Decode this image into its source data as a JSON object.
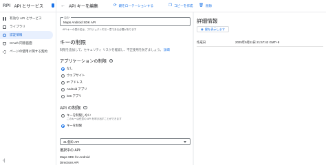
{
  "sidebar": {
    "logo": "RPI",
    "title": "API とサービス",
    "items": [
      {
        "label": "有効な API とサービス",
        "icon": "grid-icon",
        "active": false
      },
      {
        "label": "ライブラリ",
        "icon": "library-icon",
        "active": false
      },
      {
        "label": "認証情報",
        "icon": "key-icon",
        "active": true
      },
      {
        "label": "OAuth 同意画面",
        "icon": "shield-icon",
        "active": false
      },
      {
        "label": "ページの使用に関する契約",
        "icon": "settings-icon",
        "active": false
      }
    ],
    "collapse_glyph": "‹|"
  },
  "toolbar": {
    "back_glyph": "←",
    "title": "API キーを編集",
    "rotate_label": "鍵をローテーションする",
    "copy_label": "コピーを作成",
    "delete_label": "削除"
  },
  "form": {
    "name_label": "名前 *",
    "name_value": "Maps Android SDK API",
    "name_hint": "API キーの表示名は、プロジェクト内で一意である必要があります"
  },
  "key_restrictions": {
    "heading": "キーの制限",
    "description": "制限を追加して、セキュリティ リスクを軽減し、不正使用を防ぎましょう。",
    "link": "詳細"
  },
  "app_restrictions": {
    "heading": "アプリケーションの制限",
    "options": [
      {
        "label": "なし",
        "checked": true
      },
      {
        "label": "ウェブサイト",
        "checked": false
      },
      {
        "label": "IP アドレス",
        "checked": false
      },
      {
        "label": "Android アプリ",
        "checked": false
      },
      {
        "label": "iOS アプリ",
        "checked": false
      }
    ]
  },
  "api_restrictions": {
    "heading": "API の制限",
    "options": [
      {
        "label": "キーを制限しない",
        "sub": "このキーは任意の API を呼び出すことができます",
        "checked": false
      },
      {
        "label": "キーを制限",
        "sub": "",
        "checked": true
      }
    ],
    "select_value": "31 個の API",
    "selected_heading": "選択中の API:",
    "selected_apis": [
      "Maps SDK for Android",
      "Directions API"
    ]
  },
  "details": {
    "title": "詳細情報",
    "show_key_label": "鍵を表示します",
    "created_label": "作成日",
    "created_value": "2025年9月11日 21:57:42 GMT+9"
  },
  "colors": {
    "accent": "#1a73e8",
    "active_bg": "#e8f0fe"
  }
}
